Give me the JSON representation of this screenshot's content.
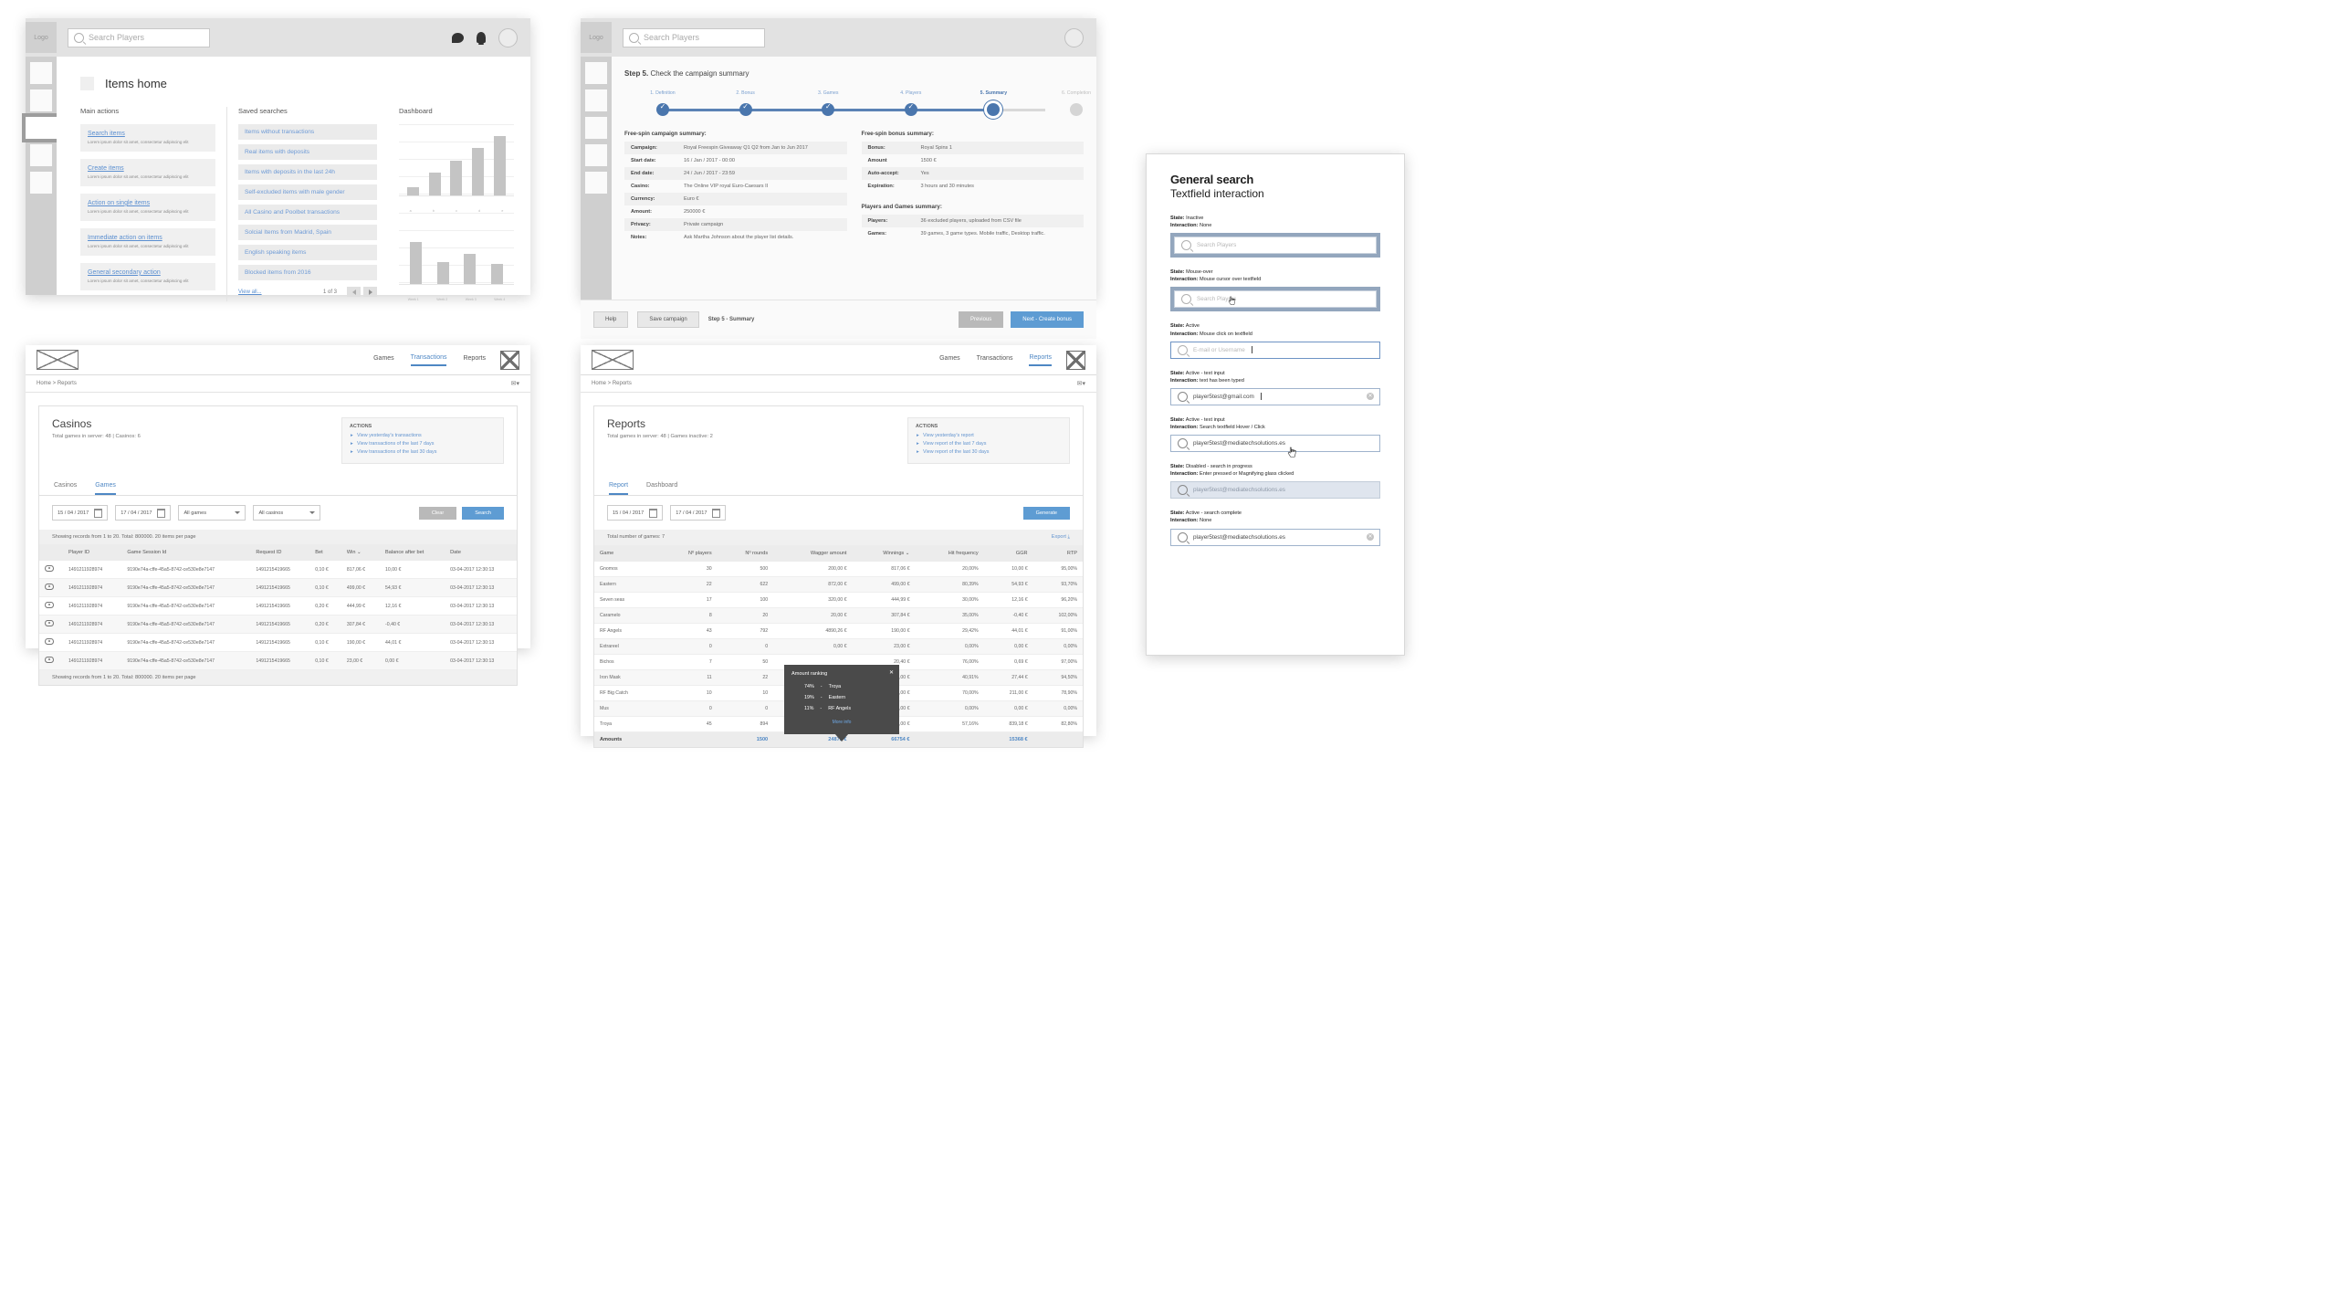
{
  "panel1": {
    "name": "items-home",
    "search_placeholder": "Search Players",
    "logo_label": "Logo",
    "page_title": "Items home",
    "main_actions_header": "Main actions",
    "saved_searches_header": "Saved searches",
    "dashboard_header": "Dashboard",
    "actions": [
      {
        "title": "Search items",
        "desc": "Lorem ipsum dolor sit amet, consectetur adipiscing elit"
      },
      {
        "title": "Create items",
        "desc": "Lorem ipsum dolor sit amet, consectetur adipiscing elit"
      },
      {
        "title": "Action on single items",
        "desc": "Lorem ipsum dolor sit amet, consectetur adipiscing elit"
      },
      {
        "title": "Immediate action on items",
        "desc": "Lorem ipsum dolor sit amet, consectetur adipiscing elit"
      },
      {
        "title": "General secondary action",
        "desc": "Lorem ipsum dolor sit amet, consectetur adipiscing elit"
      }
    ],
    "saved_searches": [
      "Items without transactions",
      "Real items with deposits",
      "Items with deposits in the last 24h",
      "Self-excluded items with male gender",
      "All Casino and Poolbet transactions",
      "Solcial Items from Madrid, Spain",
      "English speaking items",
      "Blocked items from 2016"
    ],
    "view_all": "View all...",
    "pager": "1 of 3",
    "chart_data": [
      {
        "type": "bar",
        "title": "Dashboard",
        "categories": [
          "a",
          "b",
          "c",
          "d",
          "e"
        ],
        "values": [
          12,
          34,
          52,
          70,
          88
        ],
        "ylim": [
          0,
          100
        ],
        "grid": true
      },
      {
        "type": "bar",
        "title": "",
        "categories": [
          "Week 1",
          "Week 2",
          "Week 3",
          "Week 4"
        ],
        "values": [
          62,
          33,
          44,
          30
        ],
        "ylim": [
          0,
          100
        ],
        "grid": true
      }
    ]
  },
  "panel2": {
    "name": "campaign-summary-wizard",
    "search_placeholder": "Search Players",
    "logo_label": "Logo",
    "step_prefix": "Step 5.",
    "step_title": " Check the campaign summary",
    "steps": [
      {
        "label": "1. Definition",
        "state": "done"
      },
      {
        "label": "2. Bonus",
        "state": "done"
      },
      {
        "label": "3. Games",
        "state": "done"
      },
      {
        "label": "4. Players",
        "state": "done"
      },
      {
        "label": "5. Summary",
        "state": "current"
      },
      {
        "label": "6. Completion",
        "state": "todo"
      }
    ],
    "campaign_summary_header": "Free-spin campaign summary:",
    "campaign_rows": [
      {
        "k": "Campaign:",
        "v": "Royal Freespin Giveaway Q1 Q2 from Jan to Jun 2017"
      },
      {
        "k": "Start date:",
        "v": "16 / Jan / 2017 - 00:00"
      },
      {
        "k": "End date:",
        "v": "24 / Jun / 2017 - 23:59"
      },
      {
        "k": "Casino:",
        "v": "The Online VIP royal Euro-Caesars II"
      },
      {
        "k": "Currency:",
        "v": "Euro €"
      },
      {
        "k": "Amount:",
        "v": "250000 €"
      },
      {
        "k": "Privacy:",
        "v": "Private campaign"
      },
      {
        "k": "Notes:",
        "v": "Ask Martha Johnson about the player list details."
      }
    ],
    "bonus_summary_header": "Free-spin bonus summary:",
    "bonus_rows": [
      {
        "k": "Bonus:",
        "v": "Royal Spins 1"
      },
      {
        "k": "Amount",
        "v": "1500 €"
      },
      {
        "k": "Auto-accept:",
        "v": "Yes"
      },
      {
        "k": "Expiration:",
        "v": "3 hours and 30 minutes"
      }
    ],
    "players_games_header": "Players and Games summary:",
    "players_rows": [
      {
        "k": "Players:",
        "v": "36 excluded players, uploaded from CSV file"
      },
      {
        "k": "Games:",
        "v": "39 games, 3 game types. Mobile traffic, Desktop traffic."
      }
    ],
    "footer": {
      "help": "Help",
      "save": "Save campaign",
      "status": "Step 5 - Summary",
      "previous": "Previous",
      "next": "Next - Create bonus"
    }
  },
  "panel3": {
    "name": "casinos-transactions",
    "nav": [
      "Games",
      "Transactions",
      "Reports"
    ],
    "nav_active": "Transactions",
    "breadcrumb": "Home > Reports",
    "title": "Casinos",
    "subtitle": "Total games in server: 48 | Casinos: 6",
    "actions_header": "ACTIONS",
    "actions": [
      "View yesterday's transactions",
      "View transactions of the last 7 days",
      "View transactions of the last 30 days"
    ],
    "tabs": [
      "Casinos",
      "Games"
    ],
    "tab_active": "Games",
    "filters": {
      "date_from": "15 / 04 / 2017",
      "date_to": "17 / 04 / 2017",
      "games": "All games",
      "casinos": "All casinos",
      "clear": "Clear",
      "search": "Search"
    },
    "ribbon_top": "Showing records from 1 to 20. Total: 800000. 20 items per page",
    "ribbon_bottom": "Showing records from 1 to 20. Total: 800000. 20 items per page",
    "columns": [
      "",
      "Player ID",
      "Game Session Id",
      "Request ID",
      "Bet",
      "Win",
      "Balance after bet",
      "Date"
    ],
    "sorted_column": "Win",
    "rows": [
      [
        "1491211928974",
        "9190e74a-cffe-45a5-8742-ce530e8e7147",
        "1491215419665",
        "0,10 €",
        "817,06 €",
        "10,00 €",
        "03-04-2017 12:30:13"
      ],
      [
        "1491211928974",
        "9190e74a-cffe-45a5-8742-ce530e8e7147",
        "1491215419665",
        "0,10 €",
        "499,00 €",
        "54,93 €",
        "03-04-2017 12:30:13"
      ],
      [
        "1491211928974",
        "9190e74a-cffe-45a5-8742-ce530e8e7147",
        "1491215419665",
        "0,20 €",
        "444,99 €",
        "12,16 €",
        "03-04-2017 12:30:13"
      ],
      [
        "1491211928974",
        "9190e74a-cffe-45a5-8742-ce530e8e7147",
        "1491215419665",
        "0,20 €",
        "307,84 €",
        "-0,40 €",
        "03-04-2017 12:30:13"
      ],
      [
        "1491211928974",
        "9190e74a-cffe-45a5-8742-ce530e8e7147",
        "1491215419665",
        "0,10 €",
        "190,00 €",
        "44,01 €",
        "03-04-2017 12:30:13"
      ],
      [
        "1491211928974",
        "9190e74a-cffe-45a5-8742-ce530e8e7147",
        "1491215419665",
        "0,10 €",
        "23,00 €",
        "0,00 €",
        "03-04-2017 12:30:13"
      ]
    ]
  },
  "panel4": {
    "name": "reports-dashboard",
    "nav": [
      "Games",
      "Transactions",
      "Reports"
    ],
    "nav_active": "Reports",
    "breadcrumb": "Home > Reports",
    "title": "Reports",
    "subtitle": "Total games in server: 48 | Games inactive: 2",
    "actions_header": "ACTIONS",
    "actions": [
      "View yesterday's report",
      "View report of the last 7 days",
      "View report of the last 30 days"
    ],
    "tabs": [
      "Report",
      "Dashboard"
    ],
    "tab_active": "Report",
    "filters": {
      "date_from": "15 / 04 / 2017",
      "date_to": "17 / 04 / 2017",
      "generate": "Generate"
    },
    "ribbon": "Total number of games: 7",
    "export": "Export",
    "chart_data": {
      "type": "table",
      "title": "Reports",
      "columns": [
        "Game",
        "Nº players",
        "Nº rounds",
        "Wagger amount",
        "Winnings",
        "Hit frequency",
        "GGR",
        "RTP"
      ],
      "sorted_column": "Winnings",
      "rows": [
        {
          "Game": "Gnomos",
          "Nº players": 30,
          "Nº rounds": 500,
          "Wagger amount": "200,00 €",
          "Winnings": "817,06 €",
          "Hit frequency": "20,00%",
          "GGR": "10,00 €",
          "RTP": "95,00%"
        },
        {
          "Game": "Eastern",
          "Nº players": 22,
          "Nº rounds": 622,
          "Wagger amount": "872,00 €",
          "Winnings": "499,00 €",
          "Hit frequency": "80,39%",
          "GGR": "54,93 €",
          "RTP": "93,70%"
        },
        {
          "Game": "Seven seas",
          "Nº players": 17,
          "Nº rounds": 100,
          "Wagger amount": "320,00 €",
          "Winnings": "444,99 €",
          "Hit frequency": "30,00%",
          "GGR": "12,16 €",
          "RTP": "96,20%"
        },
        {
          "Game": "Caramelo",
          "Nº players": 8,
          "Nº rounds": 20,
          "Wagger amount": "20,00 €",
          "Winnings": "307,84 €",
          "Hit frequency": "35,00%",
          "GGR": "-0,40 €",
          "RTP": "102,00%"
        },
        {
          "Game": "RF Angels",
          "Nº players": 43,
          "Nº rounds": 792,
          "Wagger amount": "4890,26 €",
          "Winnings": "190,00 €",
          "Hit frequency": "29,42%",
          "GGR": "44,01 €",
          "RTP": "91,00%"
        },
        {
          "Game": "Extrareel",
          "Nº players": 0,
          "Nº rounds": 0,
          "Wagger amount": "0,00 €",
          "Winnings": "23,00 €",
          "Hit frequency": "0,00%",
          "GGR": "0,00 €",
          "RTP": "0,00%"
        },
        {
          "Game": "Bichos",
          "Nº players": 7,
          "Nº rounds": 50,
          "Wagger amount": "",
          "Winnings": "20,40 €",
          "Hit frequency": "76,00%",
          "GGR": "0,69 €",
          "RTP": "97,00%"
        },
        {
          "Game": "Iron Mask",
          "Nº players": 11,
          "Nº rounds": 22,
          "Wagger amount": "",
          "Winnings": "0,00 €",
          "Hit frequency": "40,91%",
          "GGR": "27,44 €",
          "RTP": "94,50%"
        },
        {
          "Game": "RF Big Catch",
          "Nº players": 10,
          "Nº rounds": 10,
          "Wagger amount": "",
          "Winnings": "0,00 €",
          "Hit frequency": "70,00%",
          "GGR": "211,00 €",
          "RTP": "78,90%"
        },
        {
          "Game": "Mus",
          "Nº players": 0,
          "Nº rounds": 0,
          "Wagger amount": "",
          "Winnings": "0,00 €",
          "Hit frequency": "0,00%",
          "GGR": "0,00 €",
          "RTP": "0,00%"
        },
        {
          "Game": "Troya",
          "Nº players": 45,
          "Nº rounds": 894,
          "Wagger amount": "",
          "Winnings": "0,00 €",
          "Hit frequency": "57,16%",
          "GGR": "839,18 €",
          "RTP": "82,80%"
        }
      ],
      "totals": {
        "label": "Amounts",
        "Nº rounds": "1500",
        "Wagger amount": "24875 €",
        "Winnings": "66754 €",
        "GGR": "15368 €"
      }
    },
    "tooltip": {
      "title": "Amount ranking",
      "close": "✕",
      "items": [
        {
          "pct": "74%",
          "dash": "-",
          "name": "Troya"
        },
        {
          "pct": "19%",
          "dash": "-",
          "name": "Eastern"
        },
        {
          "pct": "11%",
          "dash": "-",
          "name": "RF Angels"
        }
      ],
      "more": "More info"
    }
  },
  "panel5": {
    "name": "general-search-spec",
    "title": "General search",
    "subtitle": "Textfield interaction",
    "states": [
      {
        "state_label": "State:",
        "state_value": " Inactive",
        "interaction_label": "Interaction:",
        "interaction_value": " None",
        "field_value": "",
        "field_placeholder": "Search Players",
        "style": "inactive"
      },
      {
        "state_label": "State:",
        "state_value": " Mouse-over",
        "interaction_label": "Interaction:",
        "interaction_value": " Mouse cursor over textfield",
        "field_value": "",
        "field_placeholder": "Search Players",
        "style": "hover"
      },
      {
        "state_label": "State:",
        "state_value": " Active",
        "interaction_label": "Interaction:",
        "interaction_value": " Mouse click on textfield",
        "field_value": "",
        "field_placeholder": "E-mail or Username",
        "style": "active"
      },
      {
        "state_label": "State:",
        "state_value": " Active - text input",
        "interaction_label": "Interaction:",
        "interaction_value": " text has been typed",
        "field_value": "player5test@gmail.com",
        "field_placeholder": "",
        "style": "typed"
      },
      {
        "state_label": "State:",
        "state_value": " Active - text input",
        "interaction_label": "Interaction:",
        "interaction_value": " Search textfield Hover / Click",
        "field_value": "player5test@mediatechsolutions.es",
        "field_placeholder": "",
        "style": "hoverclick"
      },
      {
        "state_label": "State:",
        "state_value": " Disabled - search in progress",
        "interaction_label": "Interaction:",
        "interaction_value": " Enter pressed or Magnifying glass clicked",
        "field_value": "player5test@mediatechsolutions.es",
        "field_placeholder": "",
        "style": "disabled"
      },
      {
        "state_label": "State:",
        "state_value": " Active - search complete",
        "interaction_label": "Interaction:",
        "interaction_value": " None",
        "field_value": "player5test@mediatechsolutions.es",
        "field_placeholder": "",
        "style": "complete"
      }
    ]
  }
}
